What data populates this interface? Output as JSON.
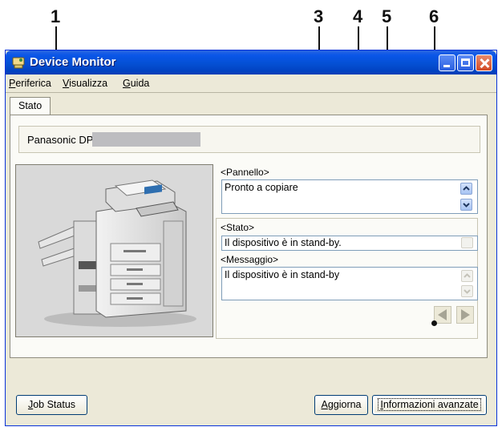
{
  "callouts": [
    "1",
    "3",
    "4",
    "5",
    "6"
  ],
  "window": {
    "title": "Device Monitor"
  },
  "menu": [
    {
      "accel": "P",
      "rest": "eriferica"
    },
    {
      "accel": "V",
      "rest": "isualizza"
    },
    {
      "accel": "G",
      "rest": "uida"
    }
  ],
  "tab": {
    "label": "Stato"
  },
  "device": {
    "name": "Panasonic DP"
  },
  "panel": {
    "label": "<Pannello>",
    "text": "Pronto a copiare"
  },
  "status": {
    "label": "<Stato>",
    "text": "Il dispositivo è in stand-by."
  },
  "message": {
    "label": "<Messaggio>",
    "text": "Il dispositivo è in stand-by"
  },
  "buttons": {
    "job_status": {
      "accel": "J",
      "rest": "ob Status"
    },
    "refresh": {
      "accel": "A",
      "rest": "ggiorna"
    },
    "advanced": {
      "accel": "I",
      "rest": "nformazioni avanzate"
    }
  },
  "colors": {
    "titlebar": "#0450d4",
    "window_bg": "#ece9d8",
    "panel_bg": "#fbfbf7",
    "field_border": "#7f9db9"
  }
}
